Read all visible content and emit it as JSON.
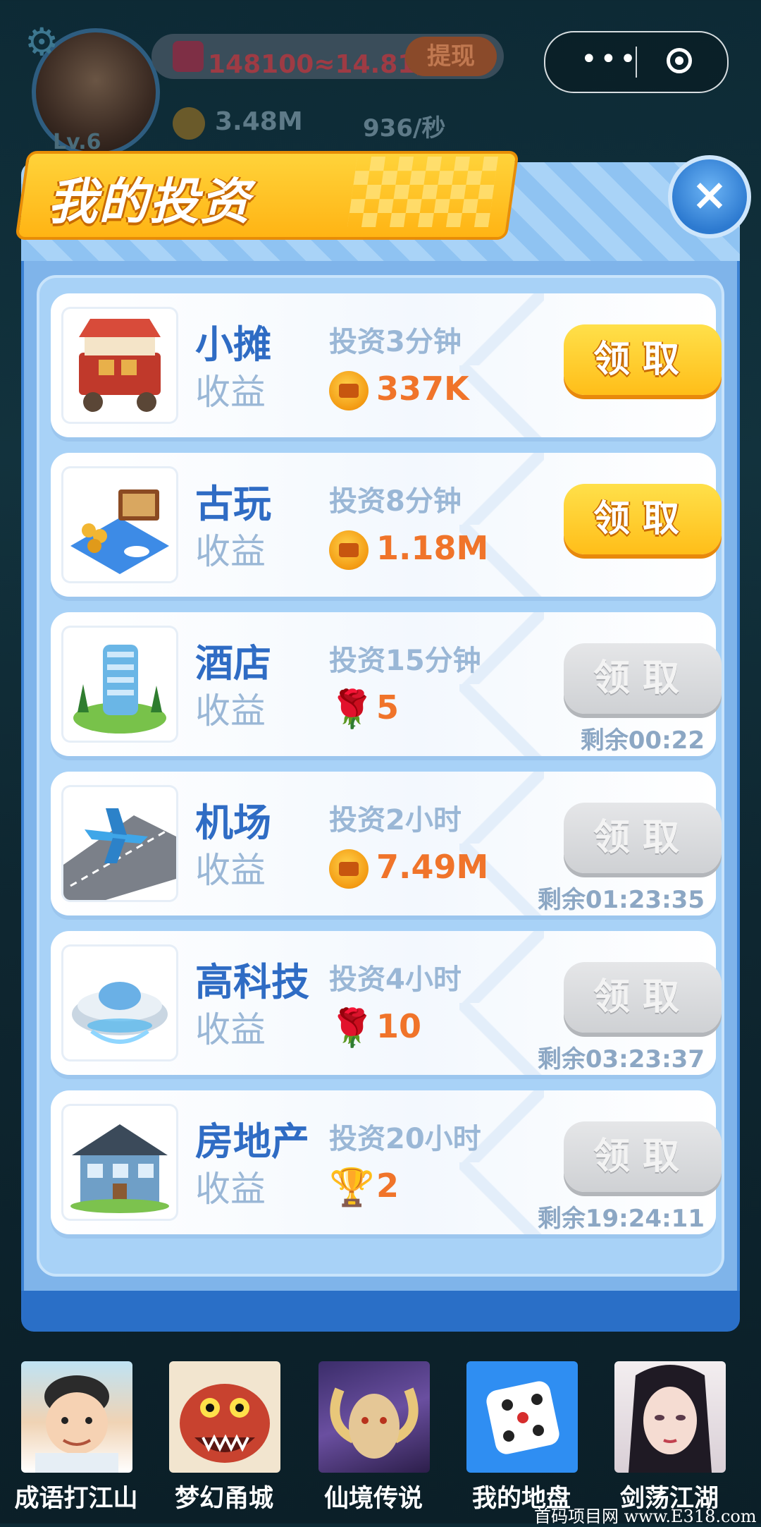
{
  "hud": {
    "money_text": "148100≈14.81元",
    "withdraw_label": "提现",
    "gold_amount": "3.48M",
    "rate": "936/秒",
    "level": "Lv.6"
  },
  "capsule": {
    "menu_icon": "more-dots-icon",
    "close_icon": "target-icon"
  },
  "modal": {
    "title": "我的投资",
    "close_symbol": "×",
    "items": [
      {
        "name": "小摊",
        "income_label": "收益",
        "duration": "投资3分钟",
        "reward_icon": "coin",
        "reward": "337K",
        "claim_label": "领取",
        "claimable": true,
        "remaining": ""
      },
      {
        "name": "古玩",
        "income_label": "收益",
        "duration": "投资8分钟",
        "reward_icon": "coin",
        "reward": "1.18M",
        "claim_label": "领取",
        "claimable": true,
        "remaining": ""
      },
      {
        "name": "酒店",
        "income_label": "收益",
        "duration": "投资15分钟",
        "reward_icon": "rose",
        "reward": "5",
        "claim_label": "领取",
        "claimable": false,
        "remaining": "剩余00:22"
      },
      {
        "name": "机场",
        "income_label": "收益",
        "duration": "投资2小时",
        "reward_icon": "coin",
        "reward": "7.49M",
        "claim_label": "领取",
        "claimable": false,
        "remaining": "剩余01:23:35"
      },
      {
        "name": "高科技",
        "income_label": "收益",
        "duration": "投资4小时",
        "reward_icon": "rose",
        "reward": "10",
        "claim_label": "领取",
        "claimable": false,
        "remaining": "剩余03:23:37"
      },
      {
        "name": "房地产",
        "income_label": "收益",
        "duration": "投资20小时",
        "reward_icon": "trophy",
        "reward": "2",
        "claim_label": "领取",
        "claimable": false,
        "remaining": "剩余19:24:11"
      }
    ]
  },
  "footer": {
    "games": [
      {
        "label": "成语打江山"
      },
      {
        "label": "梦幻甬城"
      },
      {
        "label": "仙境传说"
      },
      {
        "label": "我的地盘"
      },
      {
        "label": "剑荡江湖"
      }
    ]
  },
  "watermark": "首码项目网 www.E318.com"
}
